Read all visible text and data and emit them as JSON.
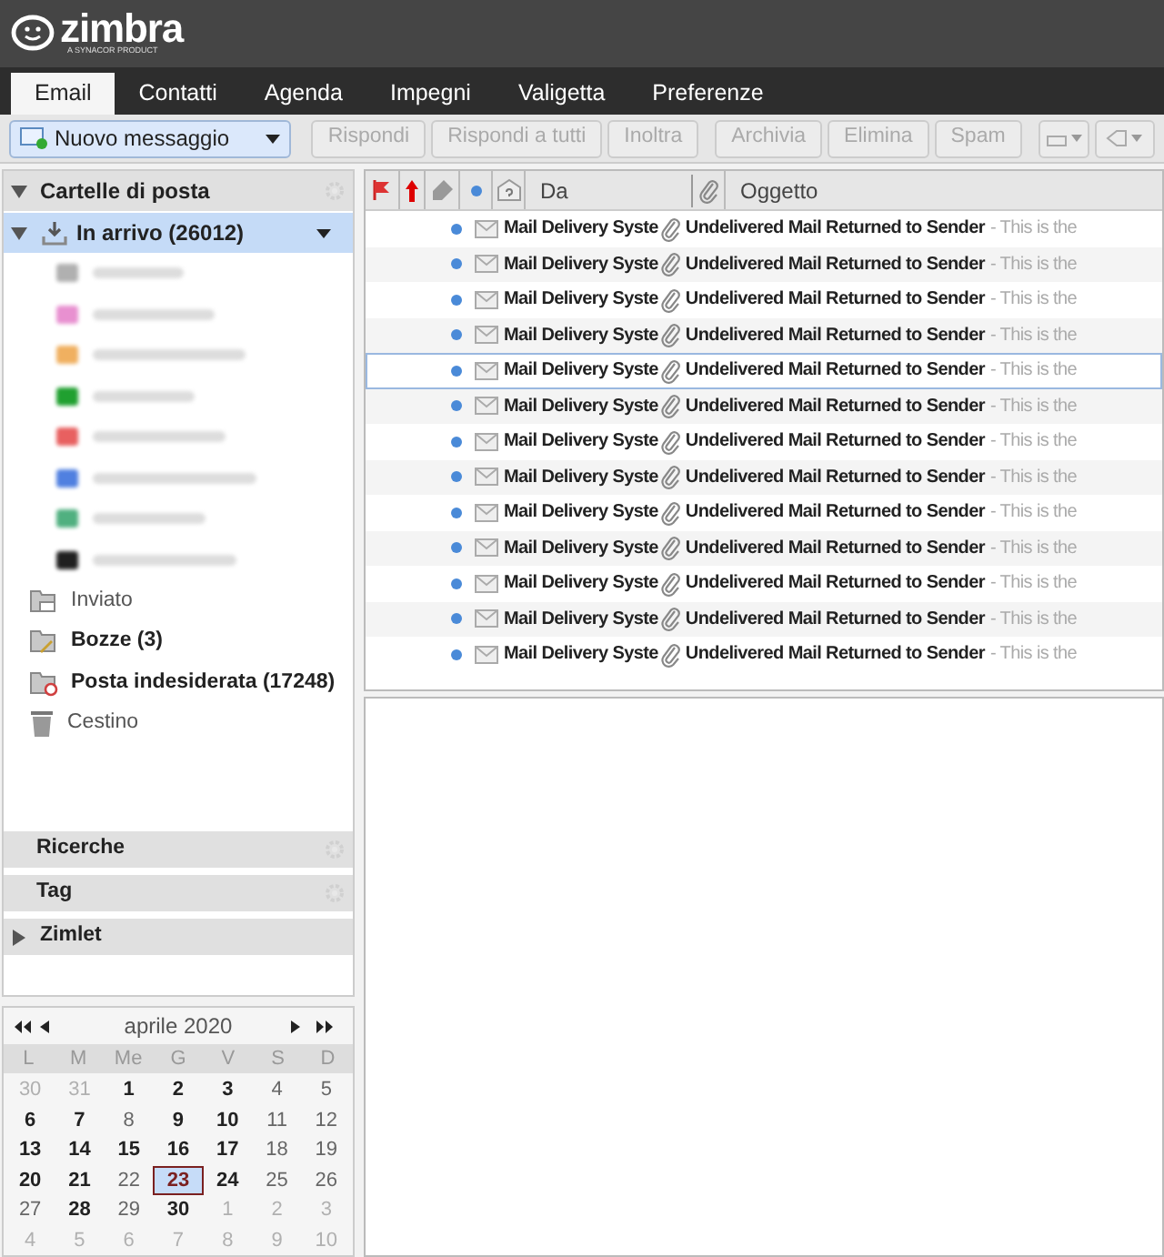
{
  "app": {
    "logo": "zimbra",
    "tagline": "A SYNACOR PRODUCT"
  },
  "tabs": [
    {
      "label": "Email",
      "selected": true
    },
    {
      "label": "Contatti",
      "selected": false
    },
    {
      "label": "Agenda",
      "selected": false
    },
    {
      "label": "Impegni",
      "selected": false
    },
    {
      "label": "Valigetta",
      "selected": false
    },
    {
      "label": "Preferenze",
      "selected": false
    }
  ],
  "toolbar": {
    "new_message": "Nuovo messaggio",
    "buttons": [
      {
        "label": "Rispondi",
        "disabled": true
      },
      {
        "label": "Rispondi a tutti",
        "disabled": true
      },
      {
        "label": "Inoltra",
        "disabled": true
      },
      {
        "label": "Archivia",
        "disabled": true
      },
      {
        "label": "Elimina",
        "disabled": true
      },
      {
        "label": "Spam",
        "disabled": true
      }
    ]
  },
  "sidebar": {
    "mail_folders_title": "Cartelle di posta",
    "inbox": {
      "label": "In arrivo (26012)",
      "selected": true,
      "expanded": true,
      "subfolders": [
        {
          "color": "#b0b0b0"
        },
        {
          "color": "#e890d0"
        },
        {
          "color": "#f0b060"
        },
        {
          "color": "#20a030"
        },
        {
          "color": "#e86060"
        },
        {
          "color": "#5080e0"
        },
        {
          "color": "#50b080"
        },
        {
          "color": "#202020"
        }
      ]
    },
    "folders": [
      {
        "label": "Inviato",
        "kind": "sent",
        "bold": false
      },
      {
        "label": "Bozze (3)",
        "kind": "drafts",
        "bold": true
      },
      {
        "label": "Posta indesiderata (17248)",
        "kind": "junk",
        "bold": true
      },
      {
        "label": "Cestino",
        "kind": "trash",
        "bold": false
      }
    ],
    "sections": [
      {
        "label": "Ricerche",
        "expanded": true
      },
      {
        "label": "Tag",
        "expanded": true
      },
      {
        "label": "Zimlet",
        "expanded": false
      }
    ]
  },
  "calendar": {
    "month": "aprile 2020",
    "weekdays": [
      "L",
      "M",
      "Me",
      "G",
      "V",
      "S",
      "D"
    ],
    "days": [
      {
        "d": "30",
        "kind": "out"
      },
      {
        "d": "31",
        "kind": "out"
      },
      {
        "d": "1",
        "kind": "busy"
      },
      {
        "d": "2",
        "kind": "busy"
      },
      {
        "d": "3",
        "kind": "busy"
      },
      {
        "d": "4",
        "kind": "free"
      },
      {
        "d": "5",
        "kind": "free"
      },
      {
        "d": "6",
        "kind": "busy"
      },
      {
        "d": "7",
        "kind": "busy"
      },
      {
        "d": "8",
        "kind": "free"
      },
      {
        "d": "9",
        "kind": "busy"
      },
      {
        "d": "10",
        "kind": "busy"
      },
      {
        "d": "11",
        "kind": "free"
      },
      {
        "d": "12",
        "kind": "free"
      },
      {
        "d": "13",
        "kind": "busy"
      },
      {
        "d": "14",
        "kind": "busy"
      },
      {
        "d": "15",
        "kind": "busy"
      },
      {
        "d": "16",
        "kind": "busy"
      },
      {
        "d": "17",
        "kind": "busy"
      },
      {
        "d": "18",
        "kind": "free"
      },
      {
        "d": "19",
        "kind": "free"
      },
      {
        "d": "20",
        "kind": "busy"
      },
      {
        "d": "21",
        "kind": "busy"
      },
      {
        "d": "22",
        "kind": "free"
      },
      {
        "d": "23",
        "kind": "today"
      },
      {
        "d": "24",
        "kind": "busy"
      },
      {
        "d": "25",
        "kind": "free"
      },
      {
        "d": "26",
        "kind": "free"
      },
      {
        "d": "27",
        "kind": "free"
      },
      {
        "d": "28",
        "kind": "busy"
      },
      {
        "d": "29",
        "kind": "free"
      },
      {
        "d": "30",
        "kind": "busy"
      },
      {
        "d": "1",
        "kind": "out"
      },
      {
        "d": "2",
        "kind": "out"
      },
      {
        "d": "3",
        "kind": "out"
      },
      {
        "d": "4",
        "kind": "out"
      },
      {
        "d": "5",
        "kind": "out"
      },
      {
        "d": "6",
        "kind": "out"
      },
      {
        "d": "7",
        "kind": "out"
      },
      {
        "d": "8",
        "kind": "out"
      },
      {
        "d": "9",
        "kind": "out"
      },
      {
        "d": "10",
        "kind": "out"
      }
    ]
  },
  "message_list": {
    "columns": {
      "from": "Da",
      "subject": "Oggetto"
    },
    "rows": [
      {
        "from": "Mail Delivery Syste",
        "subject": "Undelivered Mail Returned to Sender",
        "preview": "- This is the",
        "unread": true,
        "focused": false
      },
      {
        "from": "Mail Delivery Syste",
        "subject": "Undelivered Mail Returned to Sender",
        "preview": "- This is the",
        "unread": true,
        "focused": false
      },
      {
        "from": "Mail Delivery Syste",
        "subject": "Undelivered Mail Returned to Sender",
        "preview": "- This is the",
        "unread": true,
        "focused": false
      },
      {
        "from": "Mail Delivery Syste",
        "subject": "Undelivered Mail Returned to Sender",
        "preview": "- This is the",
        "unread": true,
        "focused": false
      },
      {
        "from": "Mail Delivery Syste",
        "subject": "Undelivered Mail Returned to Sender",
        "preview": "- This is the",
        "unread": true,
        "focused": true
      },
      {
        "from": "Mail Delivery Syste",
        "subject": "Undelivered Mail Returned to Sender",
        "preview": "- This is the",
        "unread": true,
        "focused": false
      },
      {
        "from": "Mail Delivery Syste",
        "subject": "Undelivered Mail Returned to Sender",
        "preview": "- This is the",
        "unread": true,
        "focused": false
      },
      {
        "from": "Mail Delivery Syste",
        "subject": "Undelivered Mail Returned to Sender",
        "preview": "- This is the",
        "unread": true,
        "focused": false
      },
      {
        "from": "Mail Delivery Syste",
        "subject": "Undelivered Mail Returned to Sender",
        "preview": "- This is the",
        "unread": true,
        "focused": false
      },
      {
        "from": "Mail Delivery Syste",
        "subject": "Undelivered Mail Returned to Sender",
        "preview": "- This is the",
        "unread": true,
        "focused": false
      },
      {
        "from": "Mail Delivery Syste",
        "subject": "Undelivered Mail Returned to Sender",
        "preview": "- This is the",
        "unread": true,
        "focused": false
      },
      {
        "from": "Mail Delivery Syste",
        "subject": "Undelivered Mail Returned to Sender",
        "preview": "- This is the",
        "unread": true,
        "focused": false
      },
      {
        "from": "Mail Delivery Syste",
        "subject": "Undelivered Mail Returned to Sender",
        "preview": "- This is the",
        "unread": true,
        "focused": false
      }
    ]
  }
}
